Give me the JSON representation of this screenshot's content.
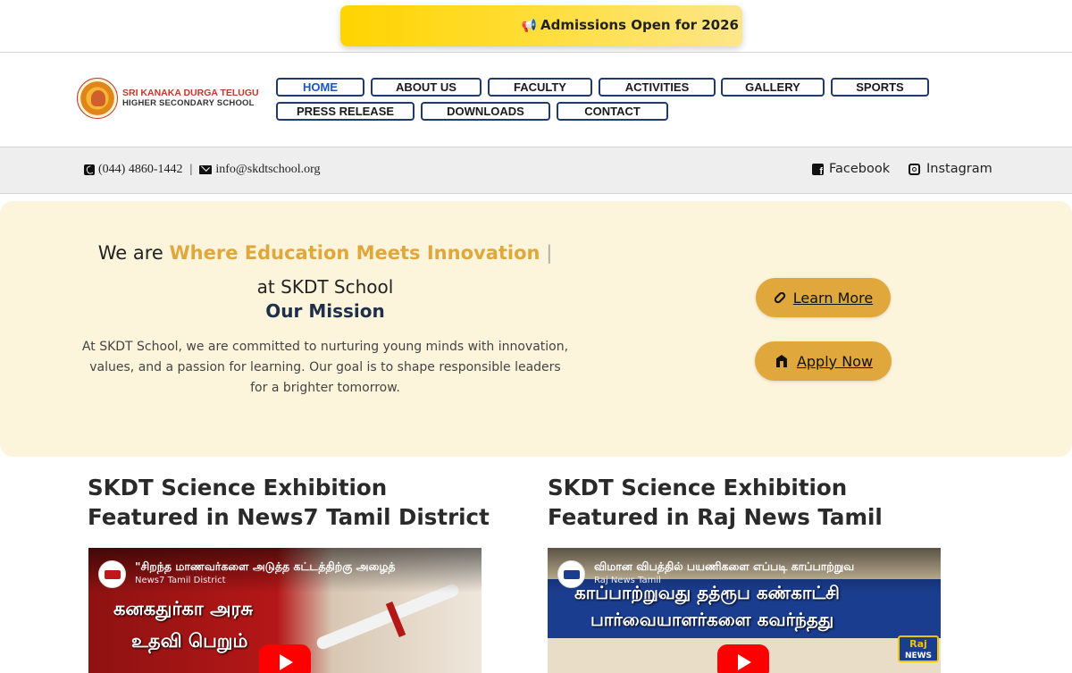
{
  "announcement": {
    "icon": "megaphone-icon",
    "text": "Admissions Open for 2026"
  },
  "logo": {
    "line1": "SRI KANAKA DURGA TELUGU",
    "line2": "HIGHER SECONDARY SCHOOL"
  },
  "nav": {
    "row1": [
      "HOME",
      "ABOUT US",
      "FACULTY",
      "ACTIVITIES",
      "GALLERY",
      "SPORTS"
    ],
    "row2": [
      "PRESS RELEASE",
      "DOWNLOADS",
      "CONTACT"
    ],
    "active": "HOME"
  },
  "contact": {
    "phone": "(044) 4860-1442",
    "separator": "|",
    "email": "info@skdtschool.org",
    "facebook": "Facebook",
    "instagram": "Instagram"
  },
  "hero": {
    "prefix": "We are ",
    "highlight": "Where Education Meets Innovation",
    "caret": "|",
    "subtitle": "at SKDT School",
    "mission_title": "Our Mission",
    "description": "At SKDT School, we are committed to nurturing young minds with innovation, values, and a passion for learning. Our goal is to shape responsible leaders for a brighter tomorrow.",
    "learn_more": "Learn More",
    "apply_now": "Apply Now"
  },
  "news": [
    {
      "title": "SKDT Science Exhibition Featured in News7 Tamil District",
      "video_title": "\"சிறந்த மாணவர்களை அடுத்த கட்டத்திற்கு அழைத்",
      "channel": "News7 Tamil District",
      "overlay_line1": "கனகதுர்கா அரசு",
      "overlay_line2": "உதவி பெறும்"
    },
    {
      "title": "SKDT Science Exhibition Featured in Raj News Tamil",
      "video_title": "விமான விபத்தில் பயணிகளை எப்படி காப்பாற்றுவ",
      "channel": "Raj News Tamil",
      "overlay_line1": "காப்பாற்றுவது தத்ரூப கண்காட்சி",
      "overlay_line2": "பார்வையாளர்களை கவர்ந்தது",
      "badge_top": "Raj",
      "badge_bottom": "NEWS"
    }
  ],
  "colors": {
    "accent": "#e0a83c",
    "nav_border": "#1e3a6e",
    "active_nav": "#1b55c7",
    "hero_bg": "#fdf4dc",
    "announce": "#ffd400"
  }
}
